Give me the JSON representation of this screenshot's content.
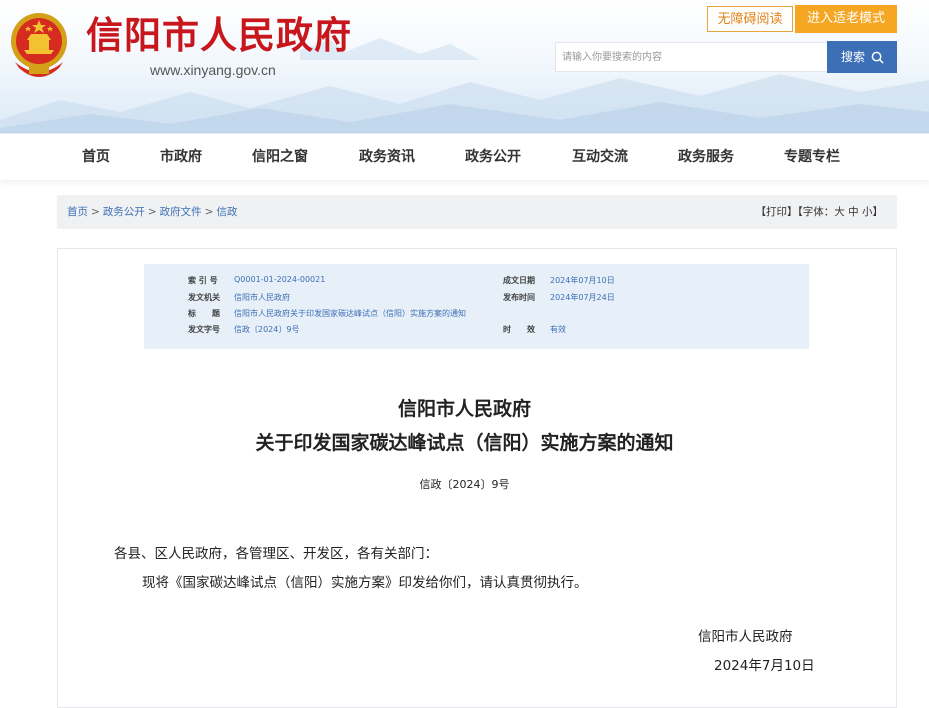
{
  "header": {
    "site_title": "信阳市人民政府",
    "site_url": "www.xinyang.gov.cn",
    "accessibility_label": "无障碍阅读",
    "elder_mode_label": "进入适老模式",
    "search_placeholder": "请输入你要搜索的内容",
    "search_button_label": "搜索"
  },
  "nav": {
    "items": [
      {
        "label": "首页"
      },
      {
        "label": "市政府"
      },
      {
        "label": "信阳之窗"
      },
      {
        "label": "政务资讯"
      },
      {
        "label": "政务公开"
      },
      {
        "label": "互动交流"
      },
      {
        "label": "政务服务"
      },
      {
        "label": "专题专栏"
      }
    ]
  },
  "breadcrumb": {
    "items": [
      "首页",
      "政务公开",
      "政府文件",
      "信政"
    ],
    "separator": ">",
    "tools": "【打印】【字体：大 中 小】"
  },
  "meta": {
    "index_label": "索 引 号",
    "index_value": "Q0001-01-2024-00021",
    "issuer_label": "发文机关",
    "issuer_value": "信阳市人民政府",
    "title_label": "标　　题",
    "title_value": "信阳市人民政府关于印发国家碳达峰试点（信阳）实施方案的通知",
    "docno_label": "发文字号",
    "docno_value": "信政〔2024〕9号",
    "date_label": "成文日期",
    "date_value": "2024年07月10日",
    "publish_label": "发布时间",
    "publish_value": "2024年07月24日",
    "validity_label": "时　　效",
    "validity_value": "有效"
  },
  "document": {
    "title_line1": "信阳市人民政府",
    "title_line2": "关于印发国家碳达峰试点（信阳）实施方案的通知",
    "doc_number": "信政〔2024〕9号",
    "salutation": "各县、区人民政府，各管理区、开发区，各有关部门：",
    "body": "现将《国家碳达峰试点（信阳）实施方案》印发给你们，请认真贯彻执行。",
    "signature": "信阳市人民政府",
    "date": "2024年7月10日"
  },
  "colors": {
    "brand_red": "#c8161d",
    "accent_blue": "#3d6fb6",
    "elder_orange": "#f5a623",
    "meta_bg": "#e7eff8"
  }
}
